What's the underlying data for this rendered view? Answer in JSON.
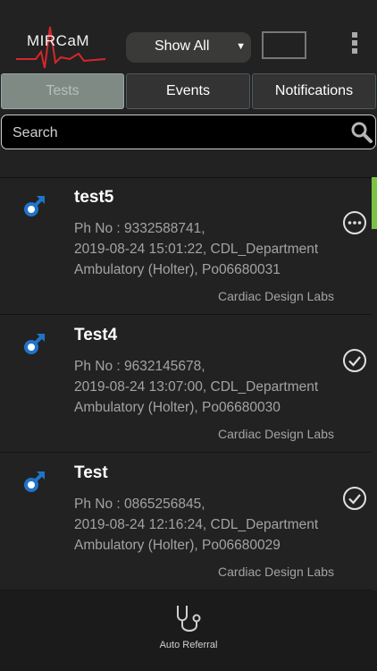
{
  "header": {
    "logo_text": "MIRCaM",
    "filter": {
      "selected": "Show All"
    }
  },
  "tabs": [
    {
      "label": "Tests",
      "active": true
    },
    {
      "label": "Events",
      "active": false
    },
    {
      "label": "Notifications",
      "active": false
    }
  ],
  "search": {
    "placeholder": "Search"
  },
  "tests": [
    {
      "name": "test5",
      "phone": "Ph No : 9332588741,",
      "details": "2019-08-24 15:01:22, CDL_Department",
      "type": "Ambulatory (Holter), Po06680031",
      "org": "Cardiac Design Labs",
      "status_icon": "more-circle-icon"
    },
    {
      "name": "Test4",
      "phone": "Ph No : 9632145678,",
      "details": "2019-08-24 13:07:00, CDL_Department",
      "type": "Ambulatory (Holter), Po06680030",
      "org": "Cardiac Design Labs",
      "status_icon": "check-circle-icon"
    },
    {
      "name": "Test",
      "phone": "Ph No : 0865256845,",
      "details": "2019-08-24 12:16:24, CDL_Department",
      "type": "Ambulatory (Holter), Po06680029",
      "org": "Cardiac Design Labs",
      "status_icon": "check-circle-icon"
    }
  ],
  "bottom": {
    "label": "Auto Referral"
  },
  "colors": {
    "accent": "#7cc242",
    "male_icon": "#1f74c9",
    "logo_red": "#d6262b"
  }
}
